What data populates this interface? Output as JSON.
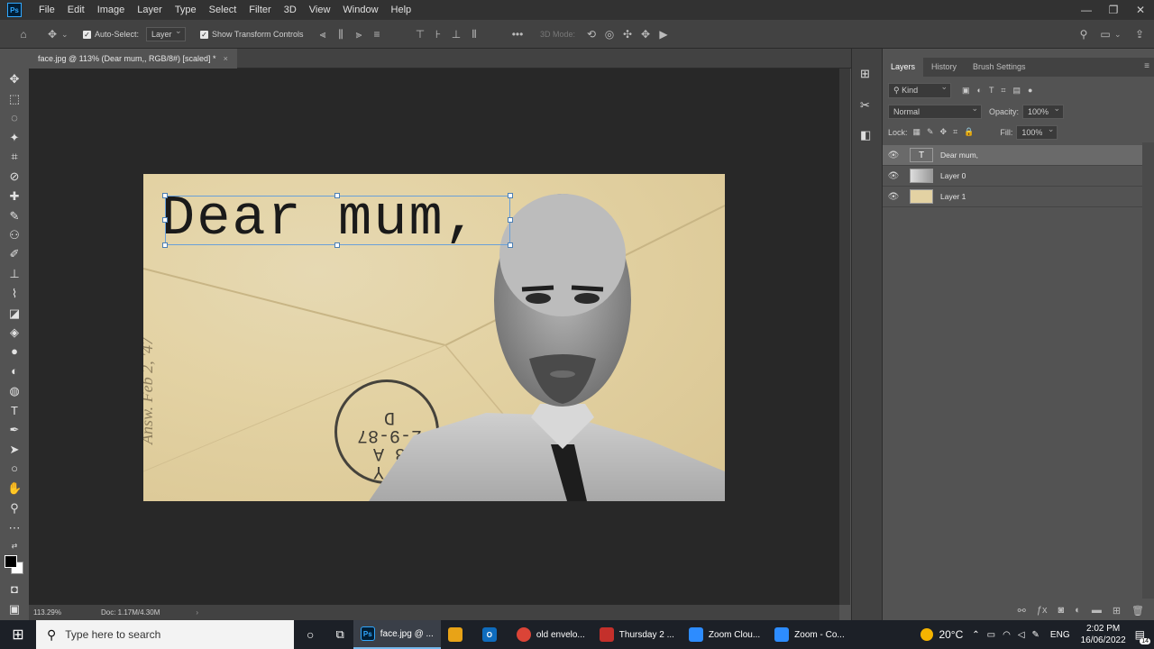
{
  "app": {
    "logo": "Ps"
  },
  "menu": [
    "File",
    "Edit",
    "Image",
    "Layer",
    "Type",
    "Select",
    "Filter",
    "3D",
    "View",
    "Window",
    "Help"
  ],
  "window_controls": {
    "minimize": "—",
    "restore": "❐",
    "close": "✕"
  },
  "options": {
    "auto_select_label": "Auto-Select:",
    "auto_select_target": "Layer",
    "transform_label": "Show Transform Controls",
    "mode_3d": "3D Mode:"
  },
  "document": {
    "tab_title": "face.jpg @ 113% (Dear mum,, RGB/8#) [scaled] *",
    "close": "×",
    "zoom": "113.29%",
    "doc_size": "Doc: 1.17M/4.30M",
    "text_layer_content": "Dear mum,",
    "stamp_text": "N Y\n8 A\n2-9-87\nD",
    "side_text": "Answ. Feb 2, '47"
  },
  "panel": {
    "tabs": [
      "Layers",
      "History",
      "Brush Settings"
    ],
    "filter_kind": "Kind",
    "blend_mode": "Normal",
    "opacity_label": "Opacity:",
    "opacity_value": "100%",
    "lock_label": "Lock:",
    "fill_label": "Fill:",
    "fill_value": "100%",
    "layers": [
      {
        "name": "Dear mum,",
        "type": "text",
        "thumb": "T",
        "selected": true
      },
      {
        "name": "Layer 0",
        "type": "image",
        "thumb": "",
        "selected": false
      },
      {
        "name": "Layer 1",
        "type": "image",
        "thumb": "",
        "selected": false
      }
    ]
  },
  "taskbar": {
    "search_placeholder": "Type here to search",
    "apps": [
      {
        "label": "face.jpg @ ...",
        "icon": "Ps",
        "color": "#001e36"
      },
      {
        "label": "",
        "icon": "📁",
        "color": "#e8a317"
      },
      {
        "label": "",
        "icon": "O",
        "color": "#0f6cbd"
      },
      {
        "label": "old envelo...",
        "icon": "●",
        "color": "#db4437"
      },
      {
        "label": "Thursday 2 ...",
        "icon": "▤",
        "color": "#c4302b"
      },
      {
        "label": "Zoom Clou...",
        "icon": "▶",
        "color": "#2d8cff"
      },
      {
        "label": "Zoom - Co...",
        "icon": "▶",
        "color": "#2d8cff"
      }
    ],
    "weather": "20°C",
    "lang": "ENG",
    "time": "2:02 PM",
    "date": "16/06/2022",
    "notifications": "14"
  }
}
